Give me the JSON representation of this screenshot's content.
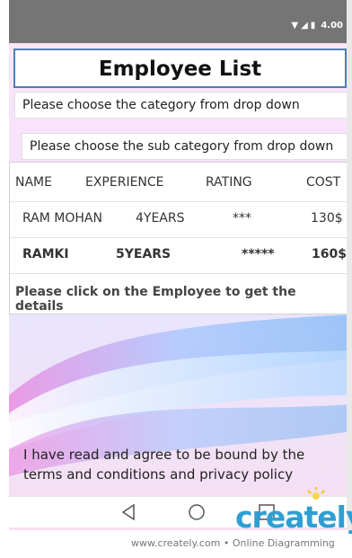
{
  "status_bar": {
    "time": "4.00",
    "icons": [
      "wifi-icon",
      "signal-icon",
      "battery-icon"
    ]
  },
  "header": {
    "title": "Employee List"
  },
  "dropdowns": {
    "category": "Please choose the category from drop down",
    "sub_category": "Please choose the sub category from drop down"
  },
  "table": {
    "headers": [
      "NAME",
      "EXPERIENCE",
      "RATING",
      "COST"
    ],
    "rows": [
      [
        "RAM MOHAN",
        "4YEARS",
        "***",
        "130$"
      ],
      [
        "RAMKI",
        "5YEARS",
        "*****",
        "160$"
      ]
    ],
    "footer": "Please click on the Employee to get the details"
  },
  "terms_text": "I have read and agree to be bound by the terms and conditions and privacy policy",
  "nav_icons": [
    "back-icon",
    "home-icon",
    "recent-apps-icon"
  ],
  "watermark": {
    "logo": "creately",
    "text": "www.creately.com • Online Diagramming"
  },
  "colors": {
    "status_bar": "#757575",
    "title_border": "#4f7fb5",
    "logo": "#2f9fd3"
  }
}
